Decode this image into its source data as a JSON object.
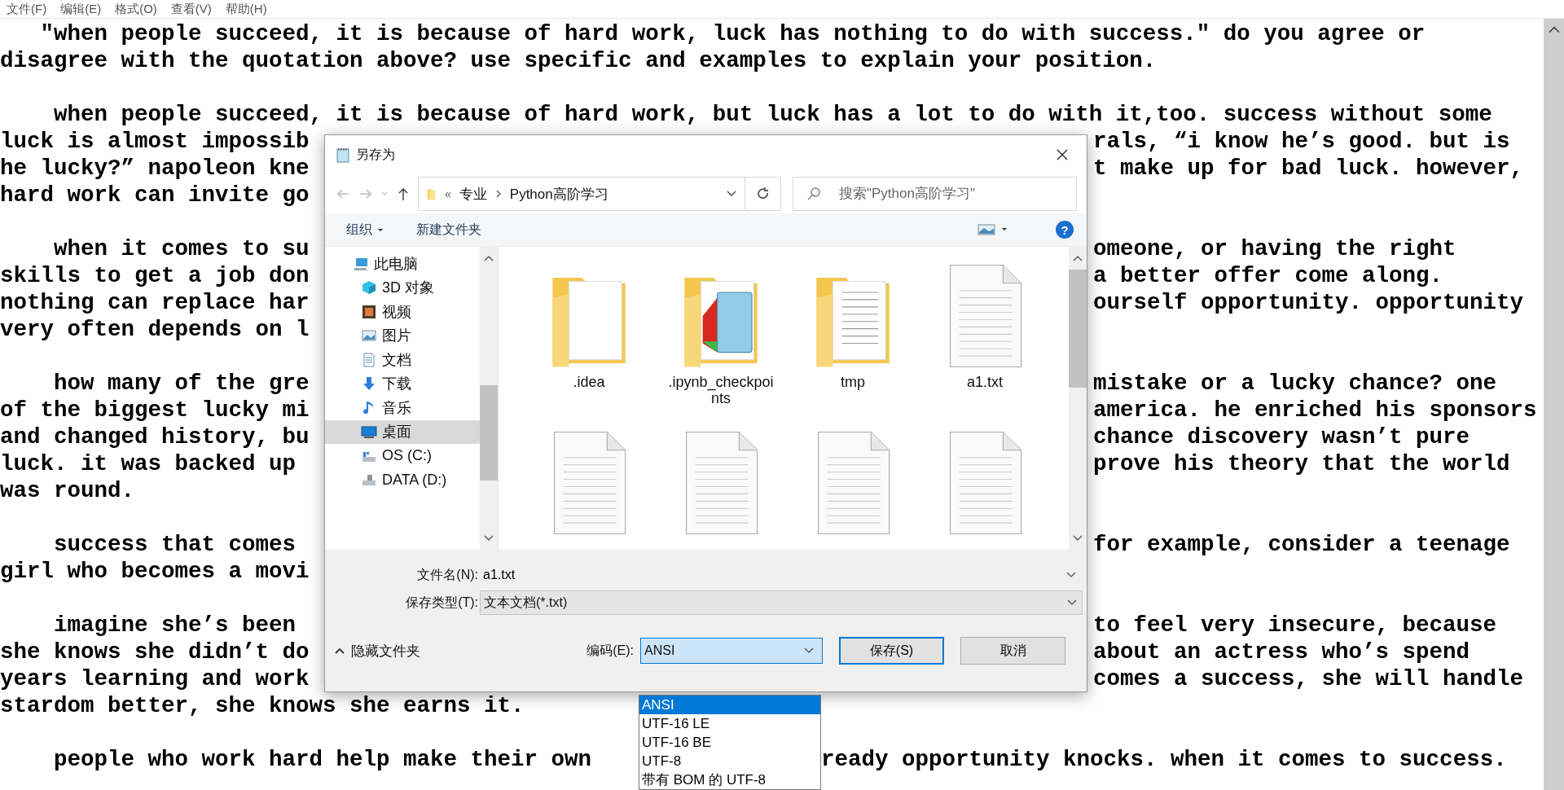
{
  "menu": [
    "文件(F)",
    "编辑(E)",
    "格式(O)",
    "查看(V)",
    "帮助(H)"
  ],
  "lines": [
    {
      "kind": "full",
      "text": "   \"when people succeed, it is because of hard work, luck has nothing to do with success.\" do you agree or"
    },
    {
      "kind": "full",
      "text": "disagree with the quotation above? use specific and examples to explain your position."
    },
    {
      "kind": "blank"
    },
    {
      "kind": "full",
      "text": "    when people succeed, it is because of hard work, but luck has a lot to do with it,too. success without some"
    },
    {
      "kind": "split",
      "left": "luck is almost impossib",
      "right": "rals, “i know he’s good. but is"
    },
    {
      "kind": "split",
      "left": "he lucky?” napoleon kne",
      "right": "t make up for bad luck. however,"
    },
    {
      "kind": "split",
      "left": "hard work can invite go"
    },
    {
      "kind": "blank"
    },
    {
      "kind": "split",
      "left": "    when it comes to su",
      "right": "omeone, or having the right"
    },
    {
      "kind": "split",
      "left": "skills to get a job don",
      "right": "a better offer come along."
    },
    {
      "kind": "split",
      "left": "nothing can replace har",
      "right": "ourself opportunity. opportunity"
    },
    {
      "kind": "split",
      "left": "very often depends on l"
    },
    {
      "kind": "blank"
    },
    {
      "kind": "split",
      "left": "    how many of the gre",
      "right": "mistake or a lucky chance? one"
    },
    {
      "kind": "split",
      "left": "of the biggest lucky mi",
      "right": "america. he enriched his sponsors"
    },
    {
      "kind": "split",
      "left": "and changed history, bu",
      "right": "chance discovery wasn’t pure"
    },
    {
      "kind": "split",
      "left": "luck. it was backed up",
      "right": "prove his theory that the world"
    },
    {
      "kind": "full",
      "text": "was round."
    },
    {
      "kind": "blank"
    },
    {
      "kind": "split",
      "left": "    success that comes",
      "right": "for example, consider a teenage"
    },
    {
      "kind": "split",
      "left": "girl who becomes a movi"
    },
    {
      "kind": "blank"
    },
    {
      "kind": "split",
      "left": "    imagine she’s been",
      "right": "to feel very insecure, because"
    },
    {
      "kind": "split",
      "left": "she knows she didn’t do",
      "right": "about an actress who’s spend"
    },
    {
      "kind": "split",
      "left": "years learning and work",
      "right": "comes a success, she will handle"
    },
    {
      "kind": "full",
      "text": "stardom better, she knows she earns it."
    },
    {
      "kind": "blank"
    },
    {
      "kind": "split-low",
      "left": "    people who work hard help make their own",
      "right": "ready opportunity knocks. when it comes to success."
    }
  ],
  "dialog": {
    "title": "另存为",
    "breadcrumb_overflow": "«",
    "breadcrumb": [
      "专业",
      "Python高阶学习"
    ],
    "search": {
      "placeholder": "搜索\"Python高阶学习\""
    },
    "toolbar": {
      "organize": "组织",
      "new_folder": "新建文件夹",
      "help": "?"
    },
    "nav": [
      {
        "label": "此电脑",
        "kind": "pc",
        "selected": false,
        "children": [
          {
            "label": "3D 对象",
            "kind": "cube",
            "selected": false
          },
          {
            "label": "视频",
            "kind": "video",
            "selected": false
          },
          {
            "label": "图片",
            "kind": "image",
            "selected": false
          },
          {
            "label": "文档",
            "kind": "document",
            "selected": false
          },
          {
            "label": "下载",
            "kind": "download",
            "selected": false
          },
          {
            "label": "音乐",
            "kind": "music",
            "selected": false
          },
          {
            "label": "桌面",
            "kind": "desktop",
            "selected": true
          },
          {
            "label": "OS (C:)",
            "kind": "os-drive",
            "selected": false
          },
          {
            "label": "DATA (D:)",
            "kind": "drive",
            "selected": false
          }
        ]
      }
    ],
    "files": [
      {
        "name": ".idea",
        "kind": "folder"
      },
      {
        "name": ".ipynb_checkpoints",
        "kind": "folder-notepad"
      },
      {
        "name": "tmp",
        "kind": "folder-doc"
      },
      {
        "name": "a1.txt",
        "kind": "file"
      },
      {
        "kind": "file"
      },
      {
        "kind": "file"
      },
      {
        "kind": "file"
      },
      {
        "kind": "file"
      }
    ],
    "file_name": {
      "label": "文件名(N):",
      "value": "a1.txt"
    },
    "save_type": {
      "label": "保存类型(T):",
      "value": "文本文档(*.txt)"
    },
    "hide_folders": "隐藏文件夹",
    "encoding": {
      "label": "编码(E):",
      "value": "ANSI",
      "expanded": true,
      "options": [
        {
          "label": "ANSI",
          "selected": true
        },
        {
          "label": "UTF-16 LE",
          "selected": false
        },
        {
          "label": "UTF-16 BE",
          "selected": false
        },
        {
          "label": "UTF-8",
          "selected": false
        },
        {
          "label": "带有 BOM 的 UTF-8",
          "selected": false
        }
      ]
    },
    "buttons": [
      {
        "label": "保存(S)",
        "default": true
      },
      {
        "label": "取消",
        "default": false
      }
    ]
  }
}
